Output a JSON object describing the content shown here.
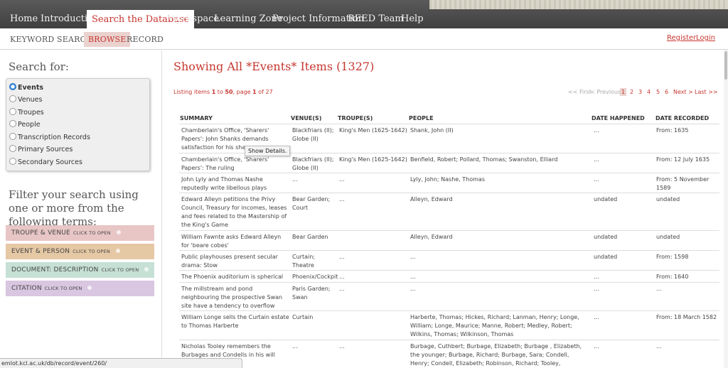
{
  "topnav": {
    "items": [
      "Home",
      "Introduction",
      "Search the Database",
      "Workspace",
      "Learning Zone",
      "Project Information",
      "REED Team",
      "Help"
    ],
    "active": "Search the Database"
  },
  "subnav": {
    "items": [
      "KEYWORD SEARCH",
      "BROWSE",
      "RECORD"
    ],
    "active": "BROWSE",
    "register": "Register",
    "login": "Login"
  },
  "sidebar": {
    "search_for": "Search for:",
    "options": [
      "Events",
      "Venues",
      "Troupes",
      "People",
      "Transcription Records",
      "Primary Sources",
      "Secondary Sources"
    ],
    "selected": "Events",
    "filter_text": "Filter your search using one or more from the following terms:",
    "filters": [
      {
        "label": "TROUPE & VENUE",
        "hint": "CLICK TO OPEN",
        "color": "#e8c6c6"
      },
      {
        "label": "EVENT & PERSON",
        "hint": "CLICK TO OPEN",
        "color": "#e5c8a4"
      },
      {
        "label": "DOCUMENT: DESCRIPTION",
        "hint": "CLICK TO OPEN",
        "color": "#c6e0d6"
      },
      {
        "label": "CITATION",
        "hint": "CLICK TO OPEN",
        "color": "#d9c6e0"
      }
    ]
  },
  "main": {
    "title": "Showing All *Events* Items (1327)",
    "listing_prefix": "Listing items ",
    "listing_from": "1",
    "listing_to_word": " to ",
    "listing_to": "50",
    "listing_page_word": ", page ",
    "listing_page": "1",
    "listing_of_word": " of ",
    "listing_total": "27",
    "pager": {
      "first": "<< First",
      "previous": "< Previous",
      "pages": [
        "1",
        "2",
        "3",
        "4",
        "5",
        "6"
      ],
      "current": "1",
      "next": "Next >",
      "last": "Last >>"
    },
    "tooltip": "Show Details.",
    "columns": [
      "SUMMARY",
      "VENUE(S)",
      "TROUPE(S)",
      "PEOPLE",
      "DATE HAPPENED",
      "DATE RECORDED"
    ],
    "rows": [
      {
        "summary": "Chamberlain's Office, 'Sharers' Papers': John Shanks demands satisfaction for his shares",
        "venues": "Blackfriars (II); Globe (II)",
        "troupes": "King's Men (1625-1642)",
        "people": "Shank, John (II)",
        "happened": "...",
        "recorded": "From: 1635"
      },
      {
        "summary": "Chamberlain's Office, 'Sharers' Papers': The ruling",
        "venues": "Blackfriars (II); Globe (II)",
        "troupes": "King's Men (1625-1642)",
        "people": "Benfield, Robert; Pollard, Thomas; Swanston, Elliard",
        "happened": "...",
        "recorded": "From: 12 July 1635"
      },
      {
        "summary": "John Lyly and Thomas Nashe reputedly write libellous plays",
        "venues": "...",
        "troupes": "...",
        "people": "Lyly, John; Nashe, Thomas",
        "happened": "...",
        "recorded": "From: 5 November 1589"
      },
      {
        "summary": "Edward Alleyn petitions the Privy Council, Treasury for incomes, leases and fees related to the Mastership of the King's Game",
        "venues": "Bear Garden; Court",
        "troupes": "...",
        "people": "Alleyn, Edward",
        "happened": "undated",
        "recorded": "undated"
      },
      {
        "summary": "William Fawnte asks Edward Alleyn for 'beare cobes'",
        "venues": "Bear Garden",
        "troupes": "",
        "people": "Alleyn, Edward",
        "happened": "undated",
        "recorded": "undated"
      },
      {
        "summary": "Public playhouses present secular drama: Stow",
        "venues": "Curtain; Theatre",
        "troupes": "...",
        "people": "...",
        "happened": "undated",
        "recorded": "From: 1598"
      },
      {
        "summary": "The Phoenix auditorium is spherical",
        "venues": "Phoenix/Cockpit",
        "troupes": "...",
        "people": "...",
        "happened": "...",
        "recorded": "From: 1640"
      },
      {
        "summary": "The millstream and pond neighbouring the prospective Swan site have a tendency to overflow",
        "venues": "Paris Garden; Swan",
        "troupes": "...",
        "people": "...",
        "happened": "...",
        "recorded": "..."
      },
      {
        "summary": "William Longe sells the Curtain estate to Thomas Harberte",
        "venues": "Curtain",
        "troupes": "",
        "people": "Harberte, Thomas; Hickes, Richard; Lanman, Henry; Longe, William; Longe, Maurice; Manne, Robert; Medley, Robert; Wilkins, Thomas; Wilkinson, Thomas",
        "happened": "...",
        "recorded": "From: 18 March 1582"
      },
      {
        "summary": "Nicholas Tooley remembers the Burbages and Condells in his will",
        "venues": "...",
        "troupes": "...",
        "people": "Burbage, Cuthbert; Burbage, Elizabeth; Burbage , Elizabeth, the younger; Burbage, Richard; Burbage, Sara; Condell, Henry; Condell, Elizabeth; Robinson, Richard; Tooley, Nicholas; Walker, Alice",
        "happened": "...",
        "recorded": "..."
      }
    ]
  },
  "status_url": "emlot.kcl.ac.uk/db/record/event/260/",
  "colors": {
    "accent": "#c6362f",
    "nav_bg": "#4a4a4a",
    "current_bg": "#ead2cf"
  }
}
